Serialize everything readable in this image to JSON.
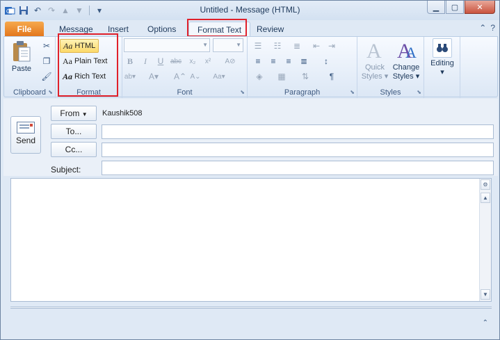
{
  "window": {
    "title": "Untitled  -  Message (HTML)",
    "controls": {
      "minimize": "▁",
      "maximize": "▢",
      "close": "✕"
    }
  },
  "qat": {
    "icons": [
      "outlook-icon",
      "save-icon",
      "undo-icon",
      "redo-icon",
      "up-arrow-icon",
      "down-arrow-icon",
      "customize-qat-icon"
    ]
  },
  "tabs": {
    "file": "File",
    "message": "Message",
    "insert": "Insert",
    "options": "Options",
    "format_text": "Format Text",
    "review": "Review"
  },
  "ribbon": {
    "clipboard": {
      "paste": "Paste",
      "label": "Clipboard"
    },
    "format": {
      "label": "Format",
      "aa": "Aa",
      "html": "HTML",
      "plain": "Plain Text",
      "rich": "Rich Text",
      "selected": "HTML"
    },
    "font": {
      "label": "Font"
    },
    "paragraph": {
      "label": "Paragraph"
    },
    "styles": {
      "label": "Styles",
      "quick_line1": "Quick",
      "quick_line2": "Styles",
      "change_line1": "Change",
      "change_line2": "Styles"
    },
    "editing": {
      "label": "Editing"
    }
  },
  "header": {
    "send": "Send",
    "from_btn": "From",
    "from_value": "Kaushik508",
    "to_btn": "To...",
    "cc_btn": "Cc...",
    "subject_label": "Subject:",
    "to_value": "",
    "cc_value": "",
    "subject_value": ""
  },
  "colors": {
    "file_tab": "#e2741a",
    "highlight_box": "#e0202a",
    "selected_format": "#fbd96a",
    "frame": "#dfe9f5"
  }
}
